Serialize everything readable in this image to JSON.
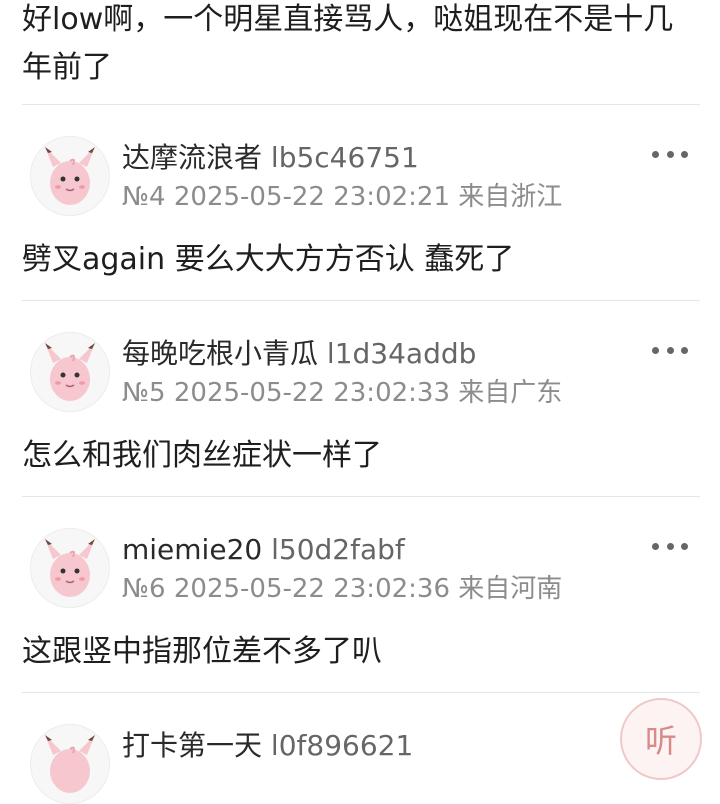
{
  "top_comment": {
    "text": "好low啊，一个明星直接骂人，哒姐现在不是十几年前了"
  },
  "posts": [
    {
      "username": "达摩流浪者",
      "uid": "lb5c46751",
      "floor": "№4",
      "datetime": "2025-05-22 23:02:21",
      "location": "来自浙江",
      "content": "劈叉again 要么大大方方否认 蠢死了"
    },
    {
      "username": "每晚吃根小青瓜",
      "uid": "l1d34addb",
      "floor": "№5",
      "datetime": "2025-05-22 23:02:33",
      "location": "来自广东",
      "content": "怎么和我们肉丝症状一样了"
    },
    {
      "username": "miemie20",
      "uid": "l50d2fabf",
      "floor": "№6",
      "datetime": "2025-05-22 23:02:36",
      "location": "来自河南",
      "content": "这跟竖中指那位差不多了叭"
    },
    {
      "username": "打卡第一天",
      "uid": "l0f896621"
    }
  ],
  "listen_button": {
    "label": "听"
  },
  "icons": {
    "avatar": "clefairy-avatar-icon",
    "more": "more-options-icon"
  },
  "colors": {
    "divider": "#e6e6e6",
    "meta_text": "#8c8c8c",
    "listen_accent": "#d88a8a"
  }
}
